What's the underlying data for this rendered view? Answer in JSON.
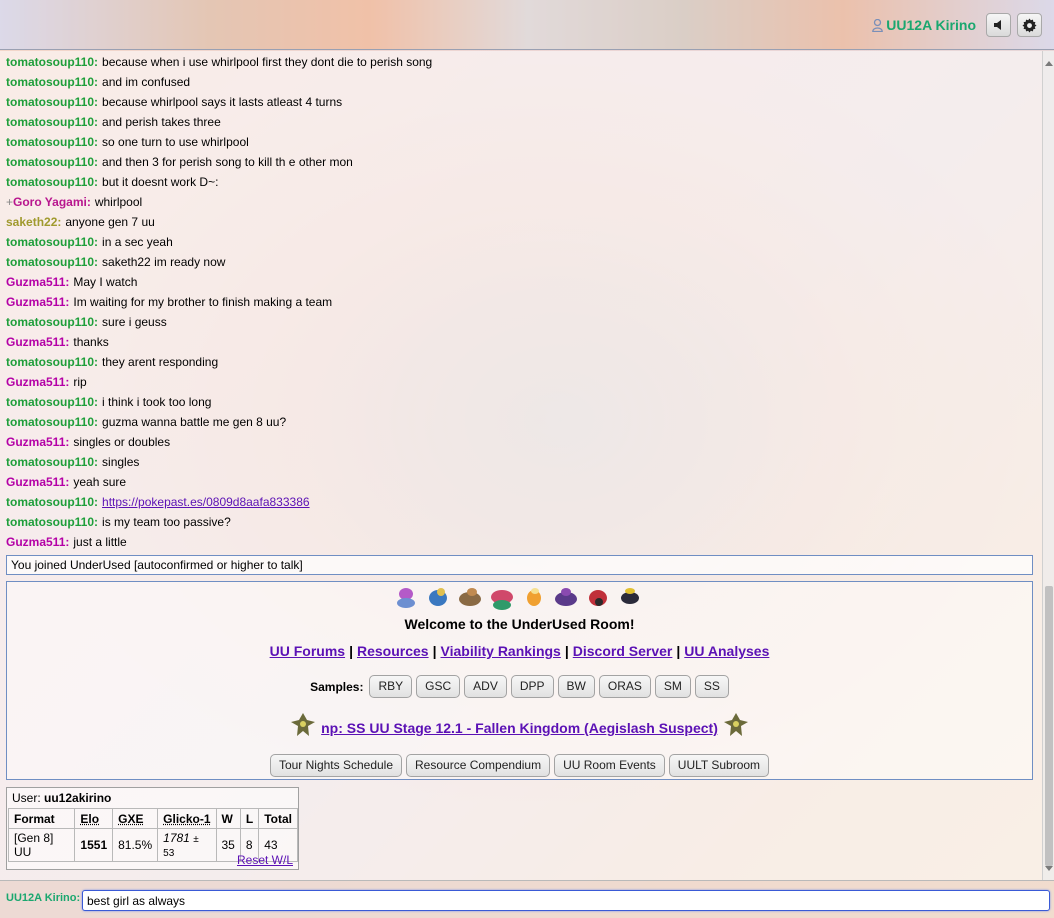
{
  "header": {
    "username": "UU12A Kirino",
    "colors": {
      "username": "#1aa76f",
      "link": "#5b11b5"
    }
  },
  "messages": [
    {
      "author": "tomatosoup110",
      "color": "#1e9e3a",
      "text": "because when i use whirlpool first they dont die to perish song"
    },
    {
      "author": "tomatosoup110",
      "color": "#1e9e3a",
      "text": "and im confused"
    },
    {
      "author": "tomatosoup110",
      "color": "#1e9e3a",
      "text": "because whirlpool says it lasts atleast 4 turns"
    },
    {
      "author": "tomatosoup110",
      "color": "#1e9e3a",
      "text": "and perish takes three"
    },
    {
      "author": "tomatosoup110",
      "color": "#1e9e3a",
      "text": "so one turn to use whirlpool"
    },
    {
      "author": "tomatosoup110",
      "color": "#1e9e3a",
      "text": "and then 3 for perish song to kill th e other mon"
    },
    {
      "author": "tomatosoup110",
      "color": "#1e9e3a",
      "text": "but it doesnt work D~:"
    },
    {
      "author": "Goro Yagami",
      "group": "+",
      "color": "#b8168e",
      "text": "whirlpool"
    },
    {
      "author": "saketh22",
      "color": "#a09a2e",
      "text": "anyone gen 7 uu"
    },
    {
      "author": "tomatosoup110",
      "color": "#1e9e3a",
      "text": "in a sec yeah"
    },
    {
      "author": "tomatosoup110",
      "color": "#1e9e3a",
      "text": "saketh22 im ready now"
    },
    {
      "author": "Guzma511",
      "color": "#b400a6",
      "text": "May I watch"
    },
    {
      "author": "Guzma511",
      "color": "#b400a6",
      "text": "Im waiting for my brother to finish making a team"
    },
    {
      "author": "tomatosoup110",
      "color": "#1e9e3a",
      "text": "sure i geuss"
    },
    {
      "author": "Guzma511",
      "color": "#b400a6",
      "text": "thanks"
    },
    {
      "author": "tomatosoup110",
      "color": "#1e9e3a",
      "text": "they arent responding"
    },
    {
      "author": "Guzma511",
      "color": "#b400a6",
      "text": "rip"
    },
    {
      "author": "tomatosoup110",
      "color": "#1e9e3a",
      "text": "i think i took too long"
    },
    {
      "author": "tomatosoup110",
      "color": "#1e9e3a",
      "text": "guzma wanna battle me gen 8 uu?"
    },
    {
      "author": "Guzma511",
      "color": "#b400a6",
      "text": "singles or doubles"
    },
    {
      "author": "tomatosoup110",
      "color": "#1e9e3a",
      "text": "singles"
    },
    {
      "author": "Guzma511",
      "color": "#b400a6",
      "text": "yeah sure"
    },
    {
      "author": "tomatosoup110",
      "color": "#1e9e3a",
      "link": "https://pokepast.es/0809d8aafa833386"
    },
    {
      "author": "tomatosoup110",
      "color": "#1e9e3a",
      "text": "is my team too passive?"
    },
    {
      "author": "Guzma511",
      "color": "#b400a6",
      "text": "just a little"
    }
  ],
  "notice": "You joined UnderUsed [autoconfirmed or higher to talk]",
  "infobox": {
    "welcome": "Welcome to the UnderUsed Room!",
    "links": [
      "UU Forums",
      "Resources",
      "Viability Rankings",
      "Discord Server",
      "UU Analyses"
    ],
    "separator": "|",
    "samples_label": "Samples:",
    "samples": [
      "RBY",
      "GSC",
      "ADV",
      "DPP",
      "BW",
      "ORAS",
      "SM",
      "SS"
    ],
    "now_playing": "np: SS UU Stage 12.1 - Fallen Kingdom (Aegislash Suspect)",
    "buttons": [
      "Tour Nights Schedule",
      "Resource Compendium",
      "UU Room Events",
      "UULT Subroom"
    ]
  },
  "stats": {
    "user_label": "User:",
    "user": "uu12akirino",
    "headers": [
      "Format",
      "Elo",
      "GXE",
      "Glicko-1",
      "W",
      "L",
      "Total"
    ],
    "row": {
      "format": "[Gen 8] UU",
      "elo": "1551",
      "gxe": "81.5%",
      "glicko": "1781",
      "glicko_dev": "± 53",
      "w": "35",
      "l": "8",
      "total": "43"
    },
    "reset": "Reset W/L"
  },
  "chatbox": {
    "name": "UU12A Kirino:",
    "value": "best girl as always"
  }
}
